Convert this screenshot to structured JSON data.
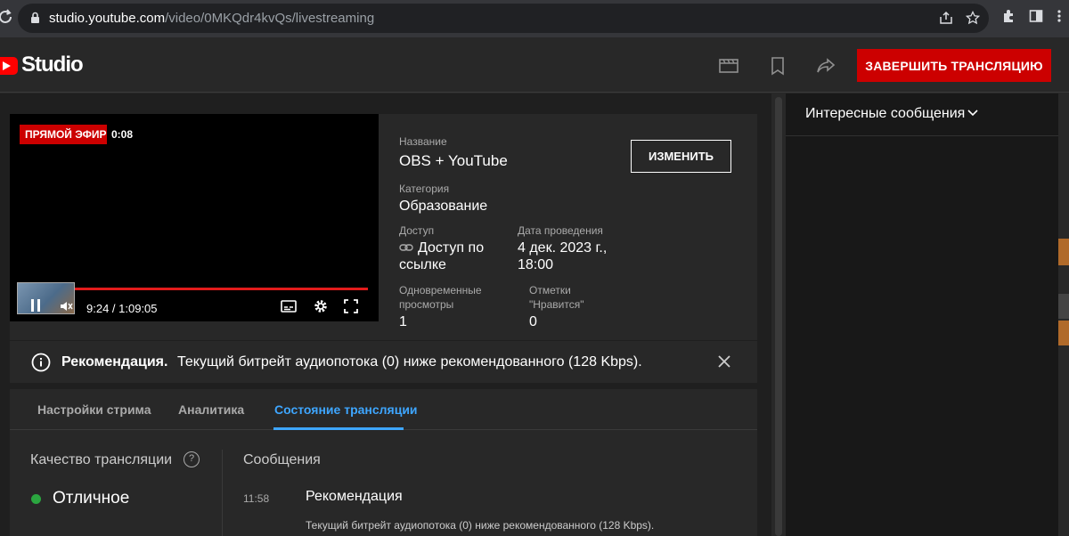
{
  "browser": {
    "url_host": "studio.youtube.com",
    "url_path": "/video/0MKQdr4kvQs/livestreaming"
  },
  "header": {
    "logo_text": "Studio",
    "end_stream_label": "ЗАВЕРШИТЬ ТРАНСЛЯЦИЮ"
  },
  "player": {
    "live_badge": "ПРЯМОЙ ЭФИР",
    "live_time": "0:08",
    "time_display": "9:24 / 1:09:05"
  },
  "details": {
    "title_label": "Название",
    "title_value": "OBS + YouTube",
    "edit_label": "ИЗМЕНИТЬ",
    "category_label": "Категория",
    "category_value": "Образование",
    "access_label": "Доступ",
    "access_value_line1": "Доступ по",
    "access_value_line2": "ссылке",
    "date_label": "Дата проведения",
    "date_value_line1": "4 дек. 2023 г.,",
    "date_value_line2": "18:00",
    "viewers_label_line1": "Одновременные",
    "viewers_label_line2": "просмотры",
    "viewers_value": "1",
    "likes_label_line1": "Отметки",
    "likes_label_line2": "\"Нравится\"",
    "likes_value": "0"
  },
  "banner": {
    "bold": "Рекомендация.",
    "text": "Текущий битрейт аудиопотока (0) ниже рекомендованного (128 Kbps)."
  },
  "tabs": [
    {
      "label": "Настройки стрима"
    },
    {
      "label": "Аналитика"
    },
    {
      "label": "Состояние трансляции",
      "active": true
    }
  ],
  "health": {
    "quality_title": "Качество трансляции",
    "help_glyph": "?",
    "quality_status": "Отличное",
    "messages_title": "Сообщения",
    "message_time": "11:58",
    "message_heading": "Рекомендация",
    "message_body": "Текущий битрейт аудиопотока (0) ниже рекомендованного (128 Kbps)."
  },
  "chat": {
    "title": "Интересные сообщения"
  },
  "colors": {
    "accent_blue": "#3ea6ff",
    "live_red": "#cc0000",
    "status_green": "#2ba640"
  }
}
